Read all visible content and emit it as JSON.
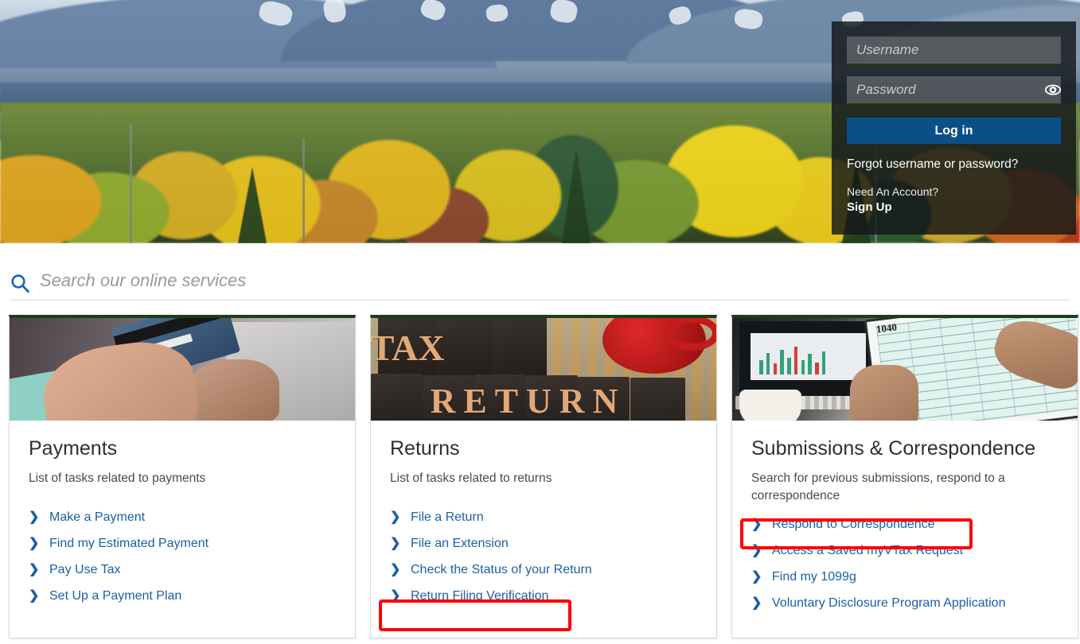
{
  "hero": {
    "image_alt": "Autumn foliage with blue mountains"
  },
  "login": {
    "username_placeholder": "Username",
    "username_value": "",
    "password_placeholder": "Password",
    "password_value": "",
    "show_password_icon": "eye-icon",
    "login_label": "Log in",
    "forgot_label": "Forgot username or password?",
    "need_account_label": "Need An Account?",
    "signup_label": "Sign Up",
    "button_color": "#0b4f87",
    "panel_color": "rgba(20,22,26,0.82)"
  },
  "search": {
    "icon": "search-icon",
    "placeholder": "Search our online services",
    "value": ""
  },
  "cards": [
    {
      "key": "payments",
      "title": "Payments",
      "subtitle": "List of tasks related to payments",
      "image_alt": "Person holding a credit card near a laptop",
      "links": [
        {
          "label": "Make a Payment",
          "highlighted": false
        },
        {
          "label": "Find my Estimated Payment",
          "highlighted": false
        },
        {
          "label": "Pay Use Tax",
          "highlighted": false
        },
        {
          "label": "Set Up a Payment Plan",
          "highlighted": false
        }
      ]
    },
    {
      "key": "returns",
      "title": "Returns",
      "subtitle": "List of tasks related to returns",
      "image_alt": "Wooden letterpress blocks spelling TAX RETURN with a red mug",
      "links": [
        {
          "label": "File a Return",
          "highlighted": false
        },
        {
          "label": "File an Extension",
          "highlighted": false
        },
        {
          "label": "Check the Status of your Return",
          "highlighted": false
        },
        {
          "label": "Return Filing Verification",
          "highlighted": true
        }
      ]
    },
    {
      "key": "submissions",
      "title": "Submissions & Correspondence",
      "subtitle": "Search for previous submissions, respond to a correspondence",
      "image_alt": "Hands holding a tablet showing a 1040 tax form",
      "links": [
        {
          "label": "Respond to Correspondence",
          "highlighted": true
        },
        {
          "label": "Access a Saved myVTax Request",
          "highlighted": false
        },
        {
          "label": "Find my 1099g",
          "highlighted": false
        },
        {
          "label": "Voluntary Disclosure Program Application",
          "highlighted": false
        }
      ]
    }
  ],
  "annotations": {
    "color": "#ff0000",
    "targets": [
      "Return Filing Verification",
      "Respond to Correspondence"
    ]
  },
  "theme": {
    "link_blue": "#1a5fa8",
    "card_top_border_green": "#1d3d17",
    "heading_gray": "#2f2f2f"
  },
  "card_art": {
    "returns_word_1": "TAX",
    "returns_word_2": "RETURN",
    "submissions_form_label": "1040"
  }
}
